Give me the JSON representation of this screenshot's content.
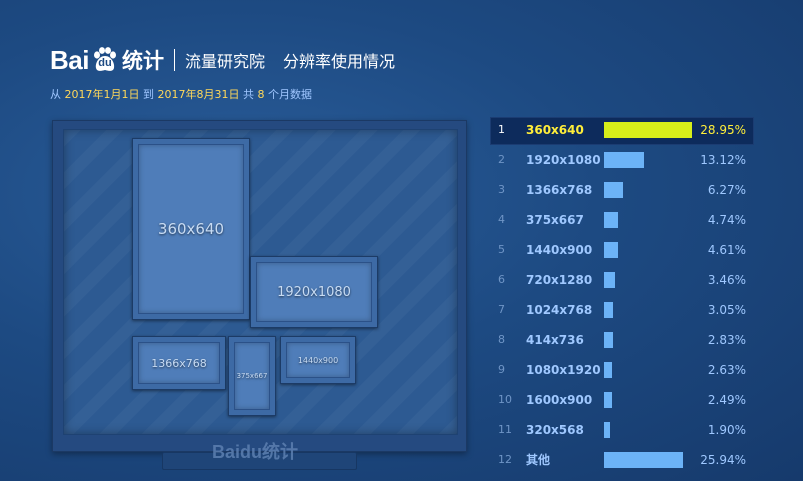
{
  "header": {
    "logo_bai": "Bai",
    "logo_du": "du",
    "logo_tongji": "统计",
    "institute": "流量研究院",
    "report_title": "分辨率使用情况"
  },
  "date_range": {
    "from_label": "从",
    "start": "2017年1月1日",
    "to_label": "到",
    "end": "2017年8月31日",
    "total_label": "共",
    "months": "8",
    "suffix": "个月数据"
  },
  "watermark": "Baidu统计",
  "colors": {
    "highlight_bar": "#d6ee1a",
    "bar": "#6cb3f7",
    "highlight_text": "#ffee3a"
  },
  "chart_data": {
    "type": "bar",
    "orientation": "horizontal",
    "ranks": [
      "1",
      "2",
      "3",
      "4",
      "5",
      "6",
      "7",
      "8",
      "9",
      "10",
      "11",
      "12"
    ],
    "categories": [
      "360x640",
      "1920x1080",
      "1366x768",
      "375x667",
      "1440x900",
      "720x1280",
      "1024x768",
      "414x736",
      "1080x1920",
      "1600x900",
      "320x568",
      "其他"
    ],
    "values": [
      28.95,
      13.12,
      6.27,
      4.74,
      4.61,
      3.46,
      3.05,
      2.83,
      2.63,
      2.49,
      1.9,
      25.94
    ],
    "value_labels": [
      "28.95%",
      "13.12%",
      "6.27%",
      "4.74%",
      "4.61%",
      "3.46%",
      "3.05%",
      "2.83%",
      "2.63%",
      "2.49%",
      "1.90%",
      "25.94%"
    ],
    "unit": "%",
    "xlim": [
      0,
      28.95
    ],
    "highlighted": "360x640",
    "grid": false
  },
  "monitor_windows": [
    "360x640",
    "1920x1080",
    "1366x768",
    "375x667",
    "1440x900"
  ]
}
